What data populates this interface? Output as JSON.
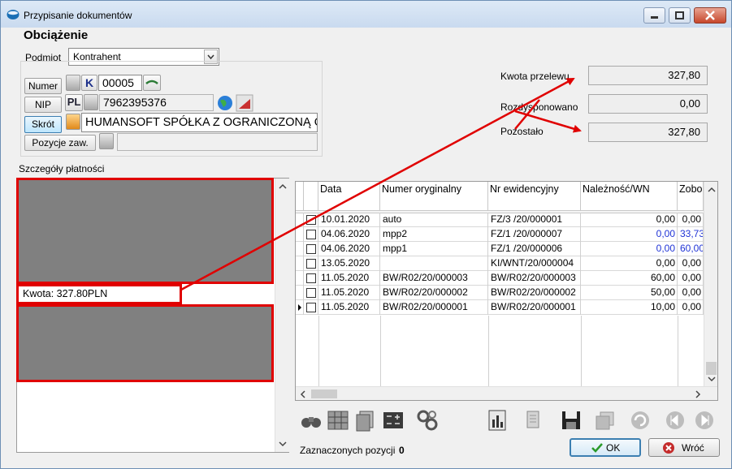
{
  "window": {
    "title": "Przypisanie dokumentów"
  },
  "heading": "Obciążenie",
  "podmiot": {
    "label": "Podmiot",
    "value": "Kontrahent"
  },
  "numer": {
    "button": "Numer",
    "prefix": "K",
    "value": "00005"
  },
  "nip": {
    "button": "NIP",
    "prefix": "PL",
    "value": "7962395376"
  },
  "skrot": {
    "button": "Skrót",
    "value": "HUMANSOFT SPÓŁKA Z OGRANICZONĄ O"
  },
  "pozycje": {
    "button": "Pozycje zaw.",
    "value": ""
  },
  "amounts": {
    "kwota_label": "Kwota przelewu",
    "kwota_value": "327,80",
    "rozdysp_label": "Rozdysponowano",
    "rozdysp_value": "0,00",
    "pozostalo_label": "Pozostało",
    "pozostalo_value": "327,80"
  },
  "szczegoly": {
    "label": "Szczegóły płatności",
    "kwota_text": "Kwota: 327.80PLN"
  },
  "grid": {
    "headers": [
      "Data",
      "Numer oryginalny",
      "Nr ewidencyjny",
      "Należność/WN",
      "Zobo"
    ],
    "rows": [
      {
        "data": "10.01.2020",
        "numer": "auto",
        "nr": "FZ/3  /20/000001",
        "nal": "0,00",
        "zob": "0,00",
        "blue": false,
        "current": false
      },
      {
        "data": "04.06.2020",
        "numer": "mpp2",
        "nr": "FZ/1  /20/000007",
        "nal": "0,00",
        "zob": "33,73",
        "blue": true,
        "current": false
      },
      {
        "data": "04.06.2020",
        "numer": "mpp1",
        "nr": "FZ/1  /20/000006",
        "nal": "0,00",
        "zob": "60,00",
        "blue": true,
        "current": false
      },
      {
        "data": "13.05.2020",
        "numer": "",
        "nr": "KI/WNT/20/000004",
        "nal": "0,00",
        "zob": "0,00",
        "blue": false,
        "current": false
      },
      {
        "data": "11.05.2020",
        "numer": "BW/R02/20/000003",
        "nr": "BW/R02/20/000003",
        "nal": "60,00",
        "zob": "0,00",
        "blue": false,
        "current": false
      },
      {
        "data": "11.05.2020",
        "numer": "BW/R02/20/000002",
        "nr": "BW/R02/20/000002",
        "nal": "50,00",
        "zob": "0,00",
        "blue": false,
        "current": false
      },
      {
        "data": "11.05.2020",
        "numer": "BW/R02/20/000001",
        "nr": "BW/R02/20/000001",
        "nal": "10,00",
        "zob": "0,00",
        "blue": false,
        "current": true
      }
    ]
  },
  "footer": {
    "selected_label": "Zaznaczonych pozycji",
    "selected_count": "0",
    "ok": "OK",
    "close": "Wróć"
  },
  "colors": {
    "highlight_red": "#e00000",
    "blue_text": "#1f33d6",
    "accent": "#3c7fb1"
  }
}
